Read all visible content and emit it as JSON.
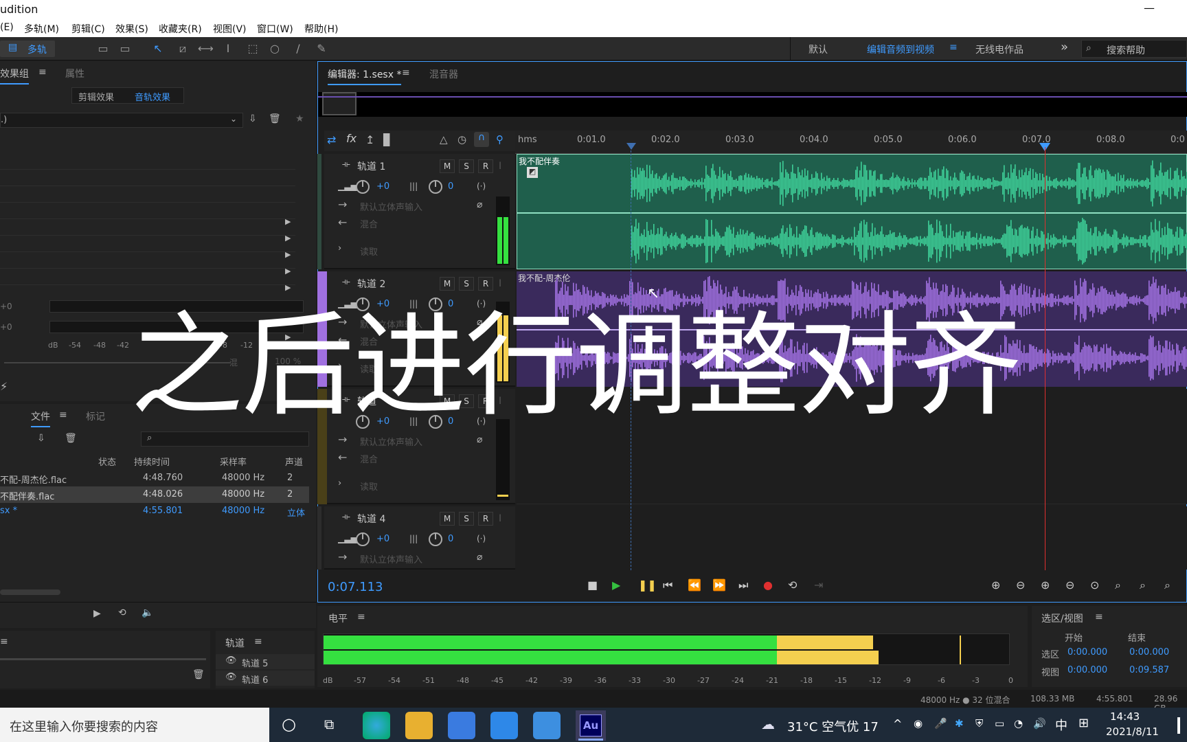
{
  "window": {
    "title": "udition"
  },
  "menu": [
    "(E)",
    "多轨(M)",
    "剪辑(C)",
    "效果(S)",
    "收藏夹(R)",
    "视图(V)",
    "窗口(W)",
    "帮助(H)"
  ],
  "toolbar": {
    "mode_label": "多轨",
    "workspace_default": "默认",
    "workspace_active": "编辑音频到视频",
    "workspace_other": "无线电作品",
    "search_placeholder": "搜索帮助"
  },
  "left_panel": {
    "tab_effects": "效果组",
    "tab_properties": "属性",
    "sub_tab_clip": "剪辑效果",
    "sub_tab_track": "音轨效果",
    "preset_value": ".)",
    "gain_1": "+0",
    "gain_2": "+0",
    "db_scale": [
      "dB",
      "-54",
      "-48",
      "-42",
      "-8",
      "-12",
      "0"
    ],
    "mix_label": "混",
    "mix_value": "100 %"
  },
  "files_panel": {
    "tab_files": "文件",
    "tab_markers": "标记",
    "columns": [
      "状态",
      "持续时间",
      "采样率",
      "声道"
    ],
    "rows": [
      {
        "name": "不配-周杰伦.flac",
        "duration": "4:48.760",
        "rate": "48000 Hz",
        "channels": "2"
      },
      {
        "name": "不配伴奏.flac",
        "duration": "4:48.026",
        "rate": "48000 Hz",
        "channels": "2"
      },
      {
        "name": "sx *",
        "duration": "4:55.801",
        "rate": "48000 Hz",
        "channels": "立体"
      }
    ]
  },
  "tracks_panel": {
    "title": "轨道",
    "items": [
      "轨道 5",
      "轨道 6"
    ]
  },
  "editor": {
    "tab_editor": "编辑器: 1.sesx *",
    "tab_mixer": "混音器",
    "ruler": [
      "hms",
      "0:01.0",
      "0:02.0",
      "0:03.0",
      "0:04.0",
      "0:05.0",
      "0:06.0",
      "0:07.0",
      "0:08.0",
      "0:0"
    ],
    "time_display": "0:07.113",
    "tracks": [
      {
        "name": "轨道 1",
        "volume": "+0",
        "pan": "0",
        "input": "默认立体声输入",
        "output": "混合",
        "automation": "读取",
        "clip": "我不配伴奏",
        "color": "#3ecf98"
      },
      {
        "name": "轨道 2",
        "volume": "+0",
        "pan": "0",
        "input": "默认立体声输入",
        "output": "混合",
        "automation": "读取",
        "clip": "我不配-周杰伦",
        "color": "#a070e0"
      },
      {
        "name": "轨道",
        "volume": "+0",
        "pan": "0",
        "input": "默认立体声输入",
        "output": "混合",
        "automation": "读取"
      },
      {
        "name": "轨道 4",
        "volume": "+0",
        "pan": "0",
        "input": "默认立体声输入"
      }
    ],
    "msr": [
      "M",
      "S",
      "R"
    ]
  },
  "overlay_caption": "之后进行调整对齐",
  "levels": {
    "title": "电平",
    "scale": [
      "dB",
      "-57",
      "-54",
      "-51",
      "-48",
      "-45",
      "-42",
      "-39",
      "-36",
      "-33",
      "-30",
      "-27",
      "-24",
      "-21",
      "-18",
      "-15",
      "-12",
      "-9",
      "-6",
      "-3",
      "0"
    ],
    "level_fraction": 0.66
  },
  "selection": {
    "title": "选区/视图",
    "start_label": "开始",
    "end_label": "结束",
    "sel_label": "选区",
    "view_label": "视图",
    "sel_start": "0:00.000",
    "sel_end": "0:00.000",
    "view_start": "0:00.000",
    "view_end": "0:09.587"
  },
  "statusbar": {
    "format": "48000 Hz ● 32 位混合",
    "memory": "108.33 MB",
    "duration": "4:55.801",
    "free": "28.96 GB"
  },
  "taskbar": {
    "search": "在这里输入你要搜索的内容",
    "weather": "31°C 空气优 17",
    "ime": "中",
    "time": "14:43",
    "date": "2021/8/11"
  },
  "colors": {
    "accent": "#3f9bff",
    "track1": "#3ecf98",
    "track2": "#a070e0",
    "meter_green": "#35e040",
    "meter_yellow": "#f4cf4f",
    "playhead": "#e03030"
  }
}
